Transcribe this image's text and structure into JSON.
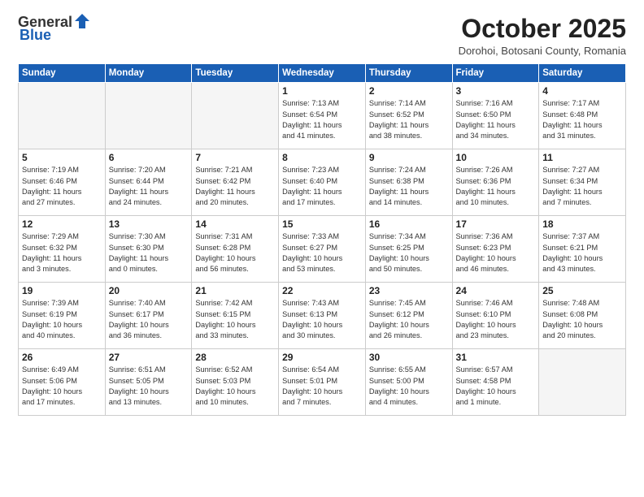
{
  "logo": {
    "general": "General",
    "blue": "Blue"
  },
  "header": {
    "title": "October 2025",
    "subtitle": "Dorohoi, Botosani County, Romania"
  },
  "weekdays": [
    "Sunday",
    "Monday",
    "Tuesday",
    "Wednesday",
    "Thursday",
    "Friday",
    "Saturday"
  ],
  "weeks": [
    [
      {
        "day": "",
        "info": ""
      },
      {
        "day": "",
        "info": ""
      },
      {
        "day": "",
        "info": ""
      },
      {
        "day": "1",
        "info": "Sunrise: 7:13 AM\nSunset: 6:54 PM\nDaylight: 11 hours\nand 41 minutes."
      },
      {
        "day": "2",
        "info": "Sunrise: 7:14 AM\nSunset: 6:52 PM\nDaylight: 11 hours\nand 38 minutes."
      },
      {
        "day": "3",
        "info": "Sunrise: 7:16 AM\nSunset: 6:50 PM\nDaylight: 11 hours\nand 34 minutes."
      },
      {
        "day": "4",
        "info": "Sunrise: 7:17 AM\nSunset: 6:48 PM\nDaylight: 11 hours\nand 31 minutes."
      }
    ],
    [
      {
        "day": "5",
        "info": "Sunrise: 7:19 AM\nSunset: 6:46 PM\nDaylight: 11 hours\nand 27 minutes."
      },
      {
        "day": "6",
        "info": "Sunrise: 7:20 AM\nSunset: 6:44 PM\nDaylight: 11 hours\nand 24 minutes."
      },
      {
        "day": "7",
        "info": "Sunrise: 7:21 AM\nSunset: 6:42 PM\nDaylight: 11 hours\nand 20 minutes."
      },
      {
        "day": "8",
        "info": "Sunrise: 7:23 AM\nSunset: 6:40 PM\nDaylight: 11 hours\nand 17 minutes."
      },
      {
        "day": "9",
        "info": "Sunrise: 7:24 AM\nSunset: 6:38 PM\nDaylight: 11 hours\nand 14 minutes."
      },
      {
        "day": "10",
        "info": "Sunrise: 7:26 AM\nSunset: 6:36 PM\nDaylight: 11 hours\nand 10 minutes."
      },
      {
        "day": "11",
        "info": "Sunrise: 7:27 AM\nSunset: 6:34 PM\nDaylight: 11 hours\nand 7 minutes."
      }
    ],
    [
      {
        "day": "12",
        "info": "Sunrise: 7:29 AM\nSunset: 6:32 PM\nDaylight: 11 hours\nand 3 minutes."
      },
      {
        "day": "13",
        "info": "Sunrise: 7:30 AM\nSunset: 6:30 PM\nDaylight: 11 hours\nand 0 minutes."
      },
      {
        "day": "14",
        "info": "Sunrise: 7:31 AM\nSunset: 6:28 PM\nDaylight: 10 hours\nand 56 minutes."
      },
      {
        "day": "15",
        "info": "Sunrise: 7:33 AM\nSunset: 6:27 PM\nDaylight: 10 hours\nand 53 minutes."
      },
      {
        "day": "16",
        "info": "Sunrise: 7:34 AM\nSunset: 6:25 PM\nDaylight: 10 hours\nand 50 minutes."
      },
      {
        "day": "17",
        "info": "Sunrise: 7:36 AM\nSunset: 6:23 PM\nDaylight: 10 hours\nand 46 minutes."
      },
      {
        "day": "18",
        "info": "Sunrise: 7:37 AM\nSunset: 6:21 PM\nDaylight: 10 hours\nand 43 minutes."
      }
    ],
    [
      {
        "day": "19",
        "info": "Sunrise: 7:39 AM\nSunset: 6:19 PM\nDaylight: 10 hours\nand 40 minutes."
      },
      {
        "day": "20",
        "info": "Sunrise: 7:40 AM\nSunset: 6:17 PM\nDaylight: 10 hours\nand 36 minutes."
      },
      {
        "day": "21",
        "info": "Sunrise: 7:42 AM\nSunset: 6:15 PM\nDaylight: 10 hours\nand 33 minutes."
      },
      {
        "day": "22",
        "info": "Sunrise: 7:43 AM\nSunset: 6:13 PM\nDaylight: 10 hours\nand 30 minutes."
      },
      {
        "day": "23",
        "info": "Sunrise: 7:45 AM\nSunset: 6:12 PM\nDaylight: 10 hours\nand 26 minutes."
      },
      {
        "day": "24",
        "info": "Sunrise: 7:46 AM\nSunset: 6:10 PM\nDaylight: 10 hours\nand 23 minutes."
      },
      {
        "day": "25",
        "info": "Sunrise: 7:48 AM\nSunset: 6:08 PM\nDaylight: 10 hours\nand 20 minutes."
      }
    ],
    [
      {
        "day": "26",
        "info": "Sunrise: 6:49 AM\nSunset: 5:06 PM\nDaylight: 10 hours\nand 17 minutes."
      },
      {
        "day": "27",
        "info": "Sunrise: 6:51 AM\nSunset: 5:05 PM\nDaylight: 10 hours\nand 13 minutes."
      },
      {
        "day": "28",
        "info": "Sunrise: 6:52 AM\nSunset: 5:03 PM\nDaylight: 10 hours\nand 10 minutes."
      },
      {
        "day": "29",
        "info": "Sunrise: 6:54 AM\nSunset: 5:01 PM\nDaylight: 10 hours\nand 7 minutes."
      },
      {
        "day": "30",
        "info": "Sunrise: 6:55 AM\nSunset: 5:00 PM\nDaylight: 10 hours\nand 4 minutes."
      },
      {
        "day": "31",
        "info": "Sunrise: 6:57 AM\nSunset: 4:58 PM\nDaylight: 10 hours\nand 1 minute."
      },
      {
        "day": "",
        "info": ""
      }
    ]
  ]
}
